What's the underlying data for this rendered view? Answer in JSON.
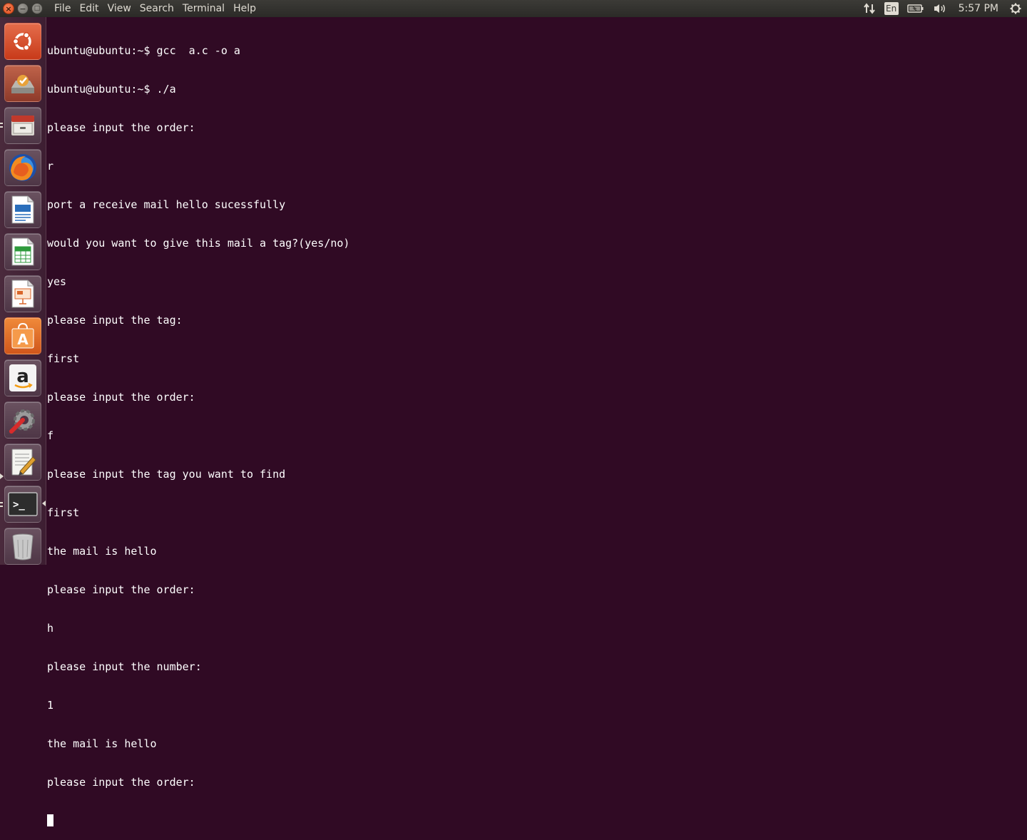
{
  "menubar": {
    "items": [
      "File",
      "Edit",
      "View",
      "Search",
      "Terminal",
      "Help"
    ]
  },
  "window_buttons": {
    "close_glyph": "×",
    "minimize_glyph": "−",
    "maximize_glyph": "□"
  },
  "indicators": {
    "network_icon": "network-transfer-icon",
    "keyboard_layout": "En",
    "battery_icon": "battery-icon",
    "sound_icon": "speaker-icon",
    "clock": "5:57 PM",
    "settings_icon": "gear-icon"
  },
  "launcher": {
    "items": [
      {
        "name": "dash-home",
        "icon": "ubuntu-logo-icon"
      },
      {
        "name": "software-updater",
        "icon": "software-updater-icon"
      },
      {
        "name": "files",
        "icon": "file-cabinet-icon"
      },
      {
        "name": "firefox",
        "icon": "firefox-icon"
      },
      {
        "name": "libreoffice-writer",
        "icon": "writer-document-icon"
      },
      {
        "name": "libreoffice-calc",
        "icon": "calc-spreadsheet-icon"
      },
      {
        "name": "libreoffice-impress",
        "icon": "impress-presentation-icon"
      },
      {
        "name": "ubuntu-software",
        "icon": "shopping-bag-icon"
      },
      {
        "name": "amazon",
        "icon": "amazon-logo-icon"
      },
      {
        "name": "system-settings",
        "icon": "wrench-gear-icon"
      },
      {
        "name": "text-editor",
        "icon": "notepad-pen-icon"
      },
      {
        "name": "terminal",
        "icon": "terminal-prompt-icon"
      },
      {
        "name": "trash",
        "icon": "trash-bin-icon"
      }
    ],
    "terminal_prompt_glyph": ">_",
    "amazon_glyph": "a",
    "store_glyph": "A"
  },
  "terminal": {
    "lines": [
      "ubuntu@ubuntu:~$ gcc  a.c -o a",
      "ubuntu@ubuntu:~$ ./a",
      "please input the order:",
      "r",
      "port a receive mail hello sucessfully",
      "would you want to give this mail a tag?(yes/no)",
      "yes",
      "please input the tag:",
      "first",
      "please input the order:",
      "f",
      "please input the tag you want to find",
      "first",
      "the mail is hello",
      "please input the order:",
      "h",
      "please input the number:",
      "1",
      "the mail is hello",
      "please input the order:"
    ]
  },
  "colors": {
    "terminal_bg": "#300a24",
    "terminal_fg": "#ffffff",
    "panel_bg": "#3c3b37",
    "panel_fg": "#dfdbd2",
    "close_button": "#df4a16"
  }
}
